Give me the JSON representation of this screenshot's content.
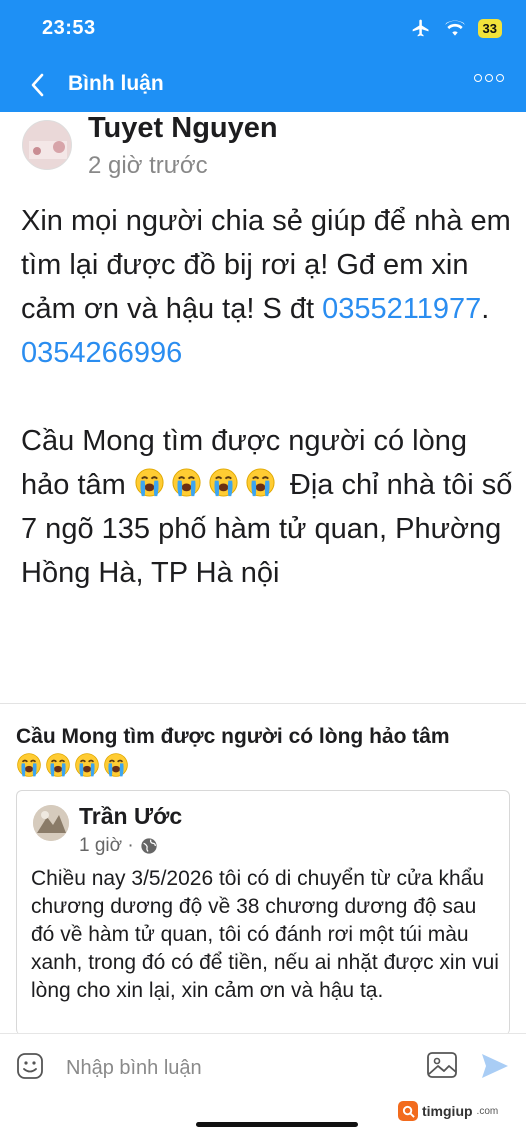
{
  "status_bar": {
    "time": "23:53",
    "battery": "33"
  },
  "header": {
    "title": "Bình luận"
  },
  "post": {
    "author": "Tuyet Nguyen",
    "time": "2 giờ trước",
    "para1_text": "Xin mọi người chia sẻ giúp để nhà em tìm lại được đồ bij rơi ạ! Gđ em xin cảm ơn và hậu tạ! S đt ",
    "phone1": "0355211977",
    "phone_sep": ". ",
    "phone2": "0354266996",
    "para2_text": "Cầu Mong tìm được người có lòng hảo tâm ",
    "para2_tail": " Địa chỉ nhà tôi số 7 ngõ 135 phố hàm tử quan, Phường Hồng Hà, TP Hà nội"
  },
  "shared": {
    "title": "Cầu Mong tìm được người có lòng hảo tâm",
    "author": "Trần Ước",
    "time": "1 giờ ·",
    "body": "Chiều nay 3/5/2026 tôi có di chuyển từ cửa khẩu chương dương độ về 38 chương dương độ sau đó về hàm tử quan, tôi có đánh rơi một túi màu xanh, trong đó có để tiền, nếu ai nhặt được xin vui lòng cho xin lại, xin cảm ơn và hậu tạ."
  },
  "comment_bar": {
    "placeholder": "Nhập bình luận"
  },
  "watermark": {
    "brand": "timgiup",
    "suffix": ".com"
  },
  "icons": {
    "emoji": "loudly-crying-face-icon",
    "back": "chevron-left-icon",
    "more": "more-options-icon",
    "globe": "globe-icon",
    "sticker": "emoji-sticker-icon",
    "image": "image-icon",
    "send": "send-icon"
  },
  "colors": {
    "header": "#1e90f5",
    "link": "#2a8df0",
    "send": "#a9cdf5"
  }
}
